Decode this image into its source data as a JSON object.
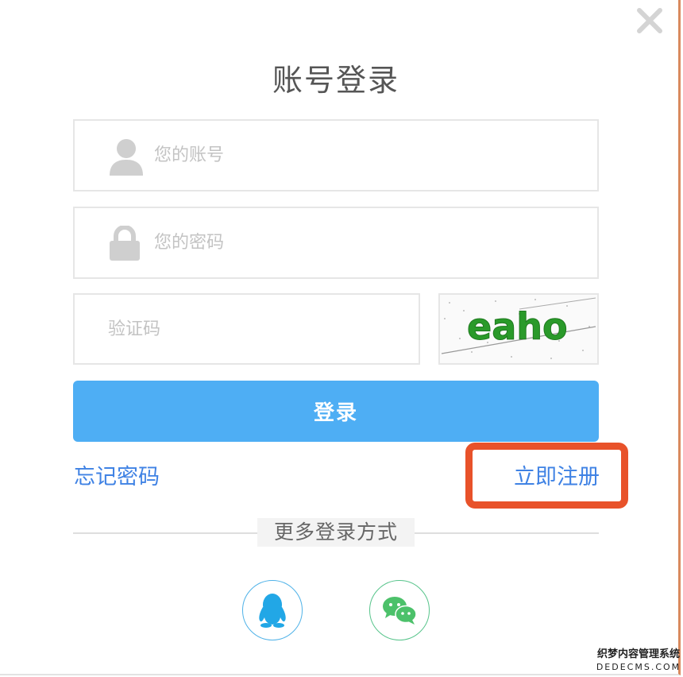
{
  "dialog": {
    "title": "账号登录",
    "close_icon": "close-icon"
  },
  "account": {
    "placeholder": "您的账号",
    "value": "",
    "icon": "user-icon"
  },
  "password": {
    "placeholder": "您的密码",
    "value": "",
    "icon": "lock-icon"
  },
  "captcha": {
    "placeholder": "验证码",
    "value": "",
    "image_text": "eaho",
    "image_color": "#2a9a2a"
  },
  "login_button": {
    "label": "登录",
    "color": "#4eaef4"
  },
  "links": {
    "forgot_password": "忘记密码",
    "register_now": "立即注册",
    "link_color": "#3f82e4",
    "highlight_color": "#e8522a"
  },
  "more_login": {
    "label": "更多登录方式",
    "options": [
      {
        "name": "QQ",
        "icon": "qq-icon",
        "color": "#22a7e6"
      },
      {
        "name": "WeChat",
        "icon": "wechat-icon",
        "color": "#4cc16a"
      }
    ]
  },
  "watermark": {
    "line1": "织梦内容管理系统",
    "line2": "DEDECMS.COM"
  }
}
